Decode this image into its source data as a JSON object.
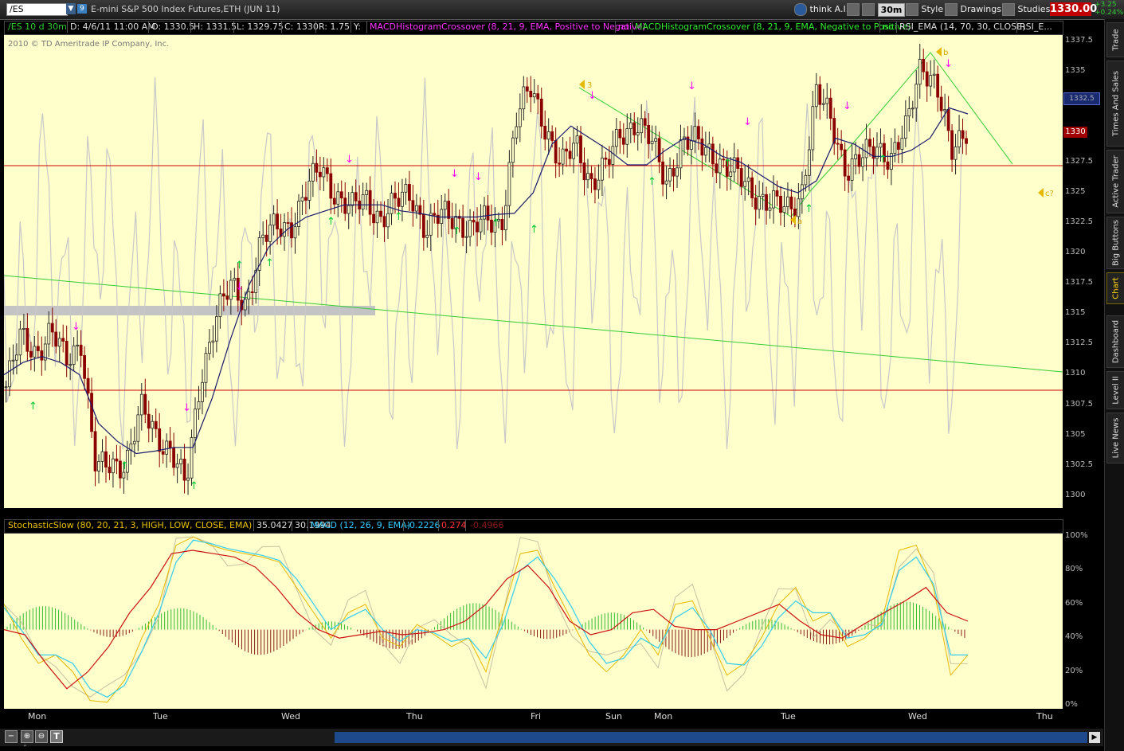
{
  "toolbar": {
    "symbol": "/ES",
    "link_number": "9",
    "description": "E-mini S&P 500 Index Futures,ETH (JUN 11)",
    "think_ai": "think A.I.",
    "timeframe": "30m",
    "style": "Style",
    "drawings": "Drawings",
    "studies": "Studies",
    "last_price": "1330.00",
    "net_change": "+3.25",
    "pct_change": "+0.24%"
  },
  "info": {
    "chart_name": "/ES 10 d 30m",
    "datetime": "D: 4/6/11 11:00 AM",
    "open": "O: 1330.5",
    "high": "H: 1331.5",
    "low": "L: 1329.75",
    "close": "C: 1330",
    "range": "R: 1.75",
    "y": "Y:",
    "study1": "MACDHistogramCrossover (8, 21, 9, EMA, Positive to Negative)",
    "no1": "no",
    "study2": "MACDHistogramCrossover (8, 21, 9, EMA, Negative to Positive)",
    "no2": "no",
    "study3": "RSI_EMA (14, 70, 30, CLOSE)",
    "study4": "RSI_E..."
  },
  "copyright": "2010 © TD Ameritrade IP Company, Inc.",
  "price_axis": {
    "ticks": [
      "1337.5",
      "1335",
      "1332.5",
      "1330",
      "1327.5",
      "1325",
      "1322.5",
      "1320",
      "1317.5",
      "1315",
      "1312.5",
      "1310",
      "1307.5",
      "1305",
      "1302.5",
      "1300"
    ],
    "marker_price": "1330",
    "marker_current": "1332.5"
  },
  "annotations": {
    "a": "a",
    "b": "b",
    "three": "3",
    "c": "c?"
  },
  "lower": {
    "stoch_label": "StochasticSlow (80, 20, 21, 3, HIGH, LOW, CLOSE, EMA)",
    "stoch_k": "35.0427",
    "stoch_d": "30.1994",
    "macd_label": "MACD (12, 26, 9, EMA)",
    "macd_value": "-0.2226",
    "macd_avg": "0.274",
    "macd_diff": "-0.4966",
    "ticks": [
      "100%",
      "80%",
      "60%",
      "40%",
      "20%",
      "0%"
    ]
  },
  "time_axis": [
    "Mon",
    "Tue",
    "Wed",
    "Thu",
    "Fri",
    "Sun",
    "Mon",
    "Tue",
    "Wed",
    "Thu"
  ],
  "sidebar_tabs": [
    "Trade",
    "Times And Sales",
    "Active Trader",
    "Big Buttons",
    "Chart",
    "Dashboard",
    "Level II",
    "Live News"
  ],
  "colors": {
    "chart_bg": "#ffffcc",
    "up_candle": "#222222",
    "down_candle": "#8b0000",
    "ema": "#1a1a6e",
    "trend": "#33cc33",
    "hline": "#cc0000",
    "rsi": "#c8c8c8",
    "up_arrow": "#00cc33",
    "down_arrow": "#ff00ff"
  },
  "chart_data": {
    "type": "candlestick",
    "title": "/ES 10 d 30m",
    "ylim": [
      1299,
      1338
    ],
    "horizontal_lines": [
      1327.5,
      1308.6
    ],
    "price_series": [
      1309,
      1313,
      1312,
      1313.5,
      1311,
      1313,
      1302,
      1302.5,
      1303,
      1307,
      1305,
      1304,
      1300.5,
      1310,
      1315,
      1317,
      1316,
      1321,
      1322,
      1322.5,
      1325,
      1327,
      1325,
      1323.5,
      1324.5,
      1323,
      1324,
      1325,
      1322,
      1323,
      1323,
      1322,
      1322.5,
      1322.5,
      1331,
      1333.5,
      1330.5,
      1327,
      1329,
      1326,
      1327,
      1330,
      1331,
      1329,
      1326,
      1329,
      1329,
      1328.5,
      1327,
      1326,
      1325,
      1324,
      1323.5,
      1325,
      1333,
      1331,
      1327,
      1327.5,
      1329,
      1328,
      1330,
      1336,
      1334,
      1328,
      1330.5
    ],
    "ema_series": [
      1310,
      1311,
      1311.5,
      1311,
      1310,
      1306,
      1304.5,
      1303.5,
      1303.7,
      1304,
      1304,
      1308,
      1313,
      1317.5,
      1320.5,
      1322,
      1323,
      1323.5,
      1324,
      1324,
      1324,
      1323.5,
      1323.3,
      1323,
      1323,
      1323,
      1323.2,
      1323.3,
      1325,
      1329,
      1330.5,
      1329.5,
      1328.5,
      1327.3,
      1327.3,
      1328.5,
      1329.5,
      1329,
      1328,
      1327.5,
      1326.5,
      1325.5,
      1325,
      1326,
      1329.5,
      1329,
      1328,
      1328,
      1328.5,
      1329.5,
      1332,
      1331.5
    ],
    "stoch_k": [
      60,
      40,
      25,
      30,
      20,
      3,
      2,
      15,
      40,
      60,
      95,
      100,
      95,
      92,
      90,
      88,
      85,
      70,
      55,
      40,
      55,
      60,
      40,
      35,
      48,
      42,
      35,
      40,
      20,
      55,
      90,
      92,
      70,
      50,
      30,
      20,
      30,
      45,
      30,
      60,
      62,
      40,
      18,
      25,
      40,
      60,
      70,
      50,
      55,
      35,
      40,
      50,
      92,
      95,
      70,
      18,
      30
    ],
    "stoch_d": [
      58,
      45,
      30,
      30,
      25,
      10,
      5,
      12,
      32,
      55,
      85,
      98,
      96,
      93,
      91,
      89,
      86,
      75,
      60,
      45,
      52,
      57,
      45,
      38,
      45,
      43,
      38,
      40,
      28,
      48,
      80,
      88,
      75,
      58,
      38,
      25,
      28,
      40,
      34,
      52,
      58,
      45,
      25,
      24,
      35,
      52,
      62,
      55,
      55,
      40,
      42,
      48,
      80,
      88,
      72,
      30,
      30
    ],
    "macd_signal": [
      45,
      42,
      25,
      10,
      20,
      35,
      55,
      70,
      90,
      92,
      90,
      88,
      82,
      70,
      55,
      45,
      40,
      42,
      44,
      42,
      43,
      45,
      50,
      60,
      75,
      83,
      70,
      50,
      42,
      45,
      55,
      57,
      47,
      45,
      45,
      50,
      55,
      60,
      50,
      42,
      40,
      48,
      55,
      62,
      70,
      55,
      50
    ]
  }
}
